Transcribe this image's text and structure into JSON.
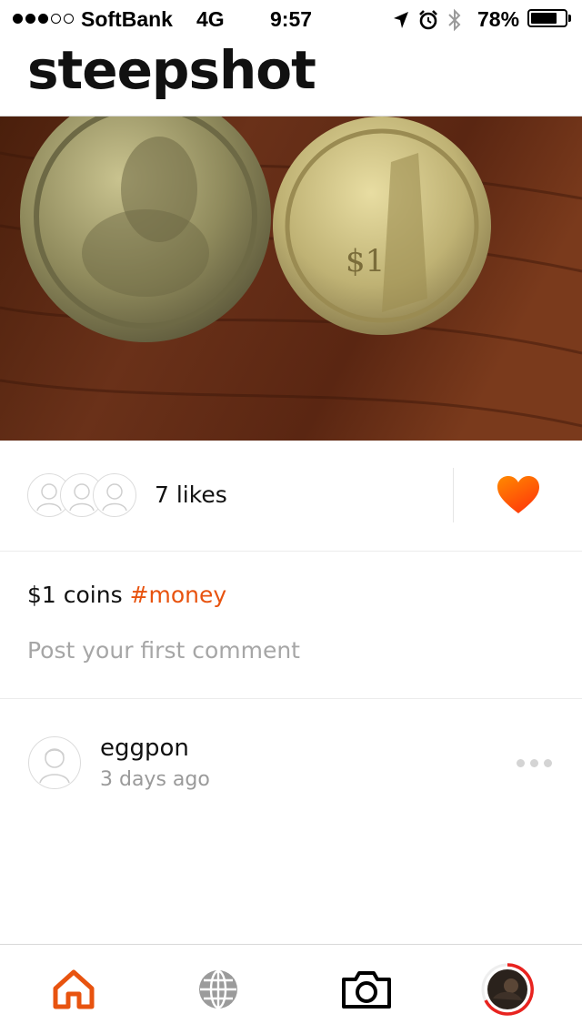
{
  "status_bar": {
    "carrier": "SoftBank",
    "network": "4G",
    "time": "9:57",
    "battery_percent": "78%",
    "battery_level": 0.78,
    "signal_bars_filled": 3,
    "signal_bars_total": 5,
    "icons": [
      "location-arrow-icon",
      "alarm-icon",
      "bluetooth-icon",
      "battery-icon"
    ]
  },
  "app": {
    "title": "steepshot"
  },
  "post": {
    "image_icon": "coin-photo",
    "likes_label": "7 likes",
    "liker_avatars": [
      "default-avatar-icon",
      "default-avatar-icon",
      "default-avatar-icon"
    ],
    "caption_text": "$1 coins ",
    "hashtag": "#money",
    "comment_placeholder": "Post your first comment",
    "author": "eggpon",
    "time_ago": "3 days ago",
    "liked": true
  },
  "tabs": [
    {
      "icon": "home-icon",
      "active": true
    },
    {
      "icon": "globe-icon",
      "active": false
    },
    {
      "icon": "camera-icon",
      "active": false
    },
    {
      "icon": "profile-avatar-icon",
      "active": false
    }
  ],
  "colors": {
    "accent": "#e8530f",
    "like_gradient_start": "#ff8a00",
    "like_gradient_end": "#ff3d0a",
    "inactive_icon": "#9b9b9b",
    "divider": "#ececec"
  }
}
